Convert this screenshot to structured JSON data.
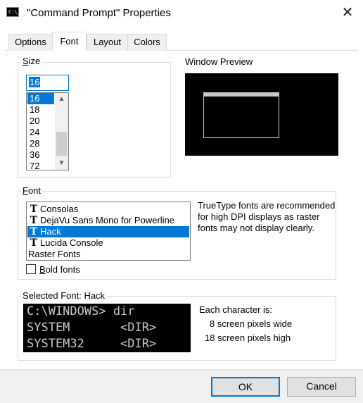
{
  "window": {
    "title": "\"Command Prompt\" Properties",
    "app_icon_text": "C:\\_",
    "close_glyph": "✕"
  },
  "tabs": [
    {
      "label": "Options"
    },
    {
      "label": "Font"
    },
    {
      "label": "Layout"
    },
    {
      "label": "Colors"
    }
  ],
  "active_tab": "Font",
  "size": {
    "label_accel": "S",
    "label_rest": "ize",
    "value": "16",
    "options": [
      "16",
      "18",
      "20",
      "24",
      "28",
      "36",
      "72"
    ],
    "selected": "16"
  },
  "preview": {
    "label": "Window Preview"
  },
  "font": {
    "label_accel": "F",
    "label_rest": "ont",
    "items": [
      {
        "name": "Consolas",
        "truetype": true
      },
      {
        "name": "DejaVu Sans Mono for Powerline",
        "truetype": true
      },
      {
        "name": "Hack",
        "truetype": true
      },
      {
        "name": "Lucida Console",
        "truetype": true
      },
      {
        "name": "Raster Fonts",
        "truetype": false
      }
    ],
    "selected": "Hack",
    "tt_icon": "T",
    "note": "TrueType fonts are recommended for high DPI displays as raster fonts may not display clearly.",
    "bold_label_accel": "B",
    "bold_label_rest": "old fonts",
    "bold_checked": false
  },
  "selected_font": {
    "label": "Selected Font: Hack",
    "sample_lines": [
      "C:\\WINDOWS> dir",
      "SYSTEM       <DIR>",
      "SYSTEM32     <DIR>"
    ],
    "char_heading": "Each character is:",
    "width_text": "8 screen pixels wide",
    "height_text": "18 screen pixels high"
  },
  "buttons": {
    "ok": "OK",
    "cancel": "Cancel"
  },
  "colors": {
    "accent": "#0078d7",
    "console_bg": "#000000",
    "console_fg": "#c8c8c8",
    "chrome": "#f0f0f0"
  }
}
